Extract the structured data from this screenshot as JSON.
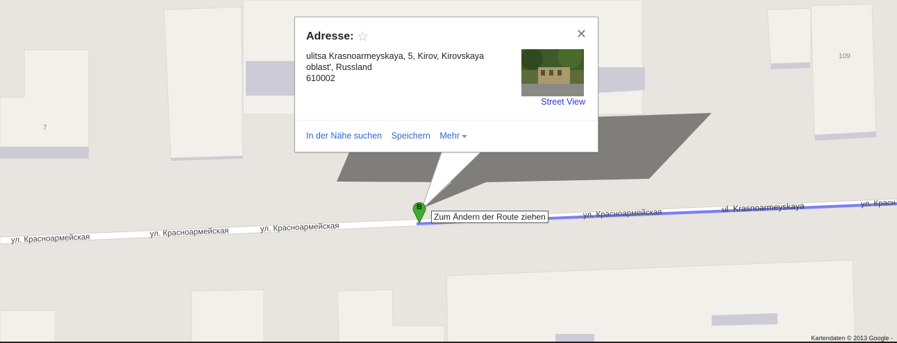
{
  "popup": {
    "title": "Adresse:",
    "star_icon": "star-outline-icon",
    "close_icon": "close-icon",
    "address_line1": "ulitsa Krasnoarmeyskaya, 5, Kirov, Kirovskaya",
    "address_line2": "oblast', Russland",
    "postcode": "610002",
    "street_view_label": "Street View",
    "actions": {
      "nearby": "In der Nähe suchen",
      "save": "Speichern",
      "more": "Mehr"
    }
  },
  "marker": {
    "label": "B",
    "color": "#3fad2e"
  },
  "route_tooltip": "Zum Ändern der Route ziehen",
  "map": {
    "street_labels": [
      "ул. Красноармейская",
      "ул. Красноармейская",
      "ул. Красноармейская",
      "ул. Красноармейская",
      "ul. Krasnoarmeyskaya",
      "ул. Красн"
    ],
    "building_numbers": [
      "7",
      "109"
    ],
    "route_color": "#7b7ff0"
  },
  "copyright": "Kartendaten © 2013 Google -"
}
